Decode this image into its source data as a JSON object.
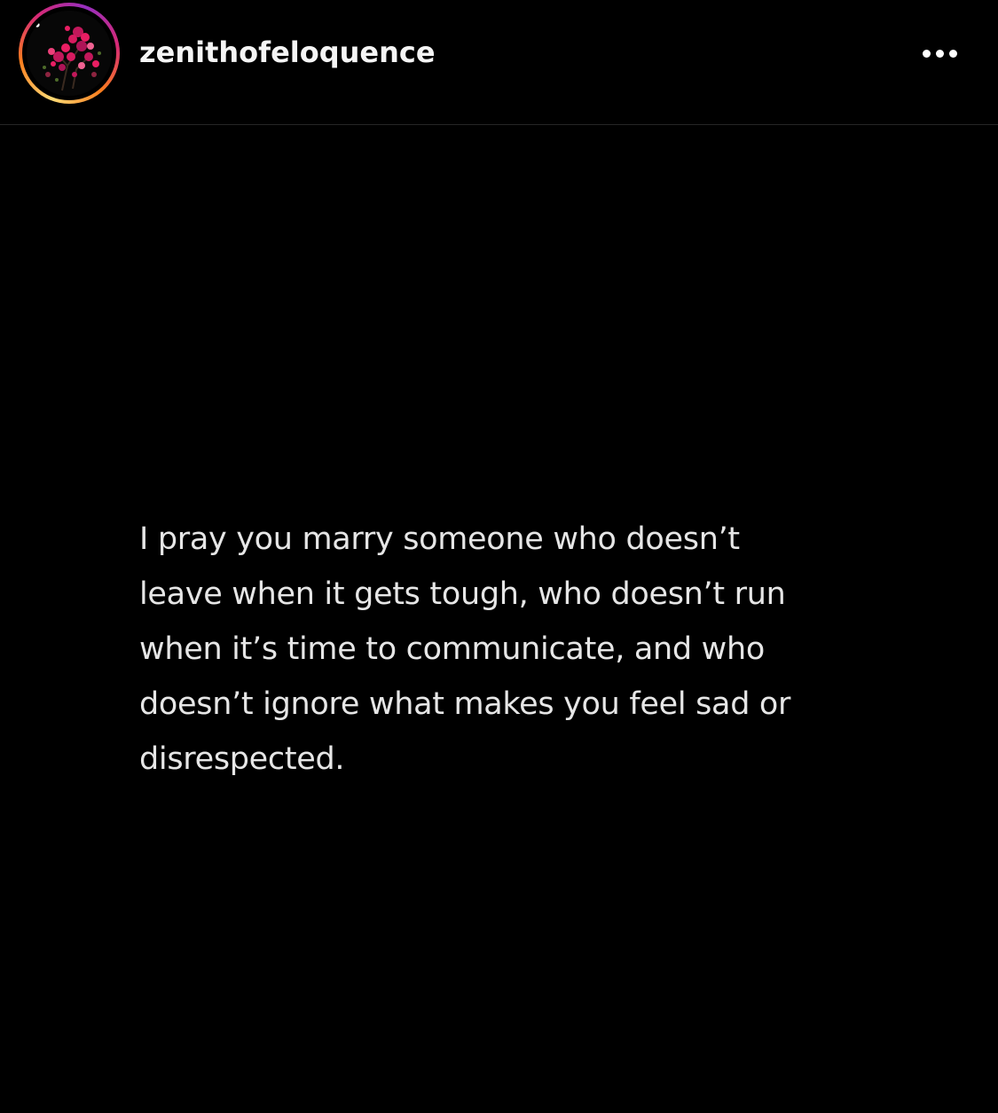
{
  "post": {
    "username": "zenithofeloquence",
    "more_icon": "more-horizontal-icon",
    "avatar_icon": "flower-avatar-icon",
    "ring_colors": [
      "#feda75",
      "#fa7e1e",
      "#d62976",
      "#962fbf"
    ],
    "background_color": "#000000",
    "text_color": "#e6e6e6",
    "quote_lines": [
      "I pray you marry someone who doesn’t",
      "leave when it gets tough, who doesn’t run",
      "when it’s time to communicate, and who",
      "doesn’t ignore what makes you feel sad or",
      "disrespected."
    ]
  }
}
